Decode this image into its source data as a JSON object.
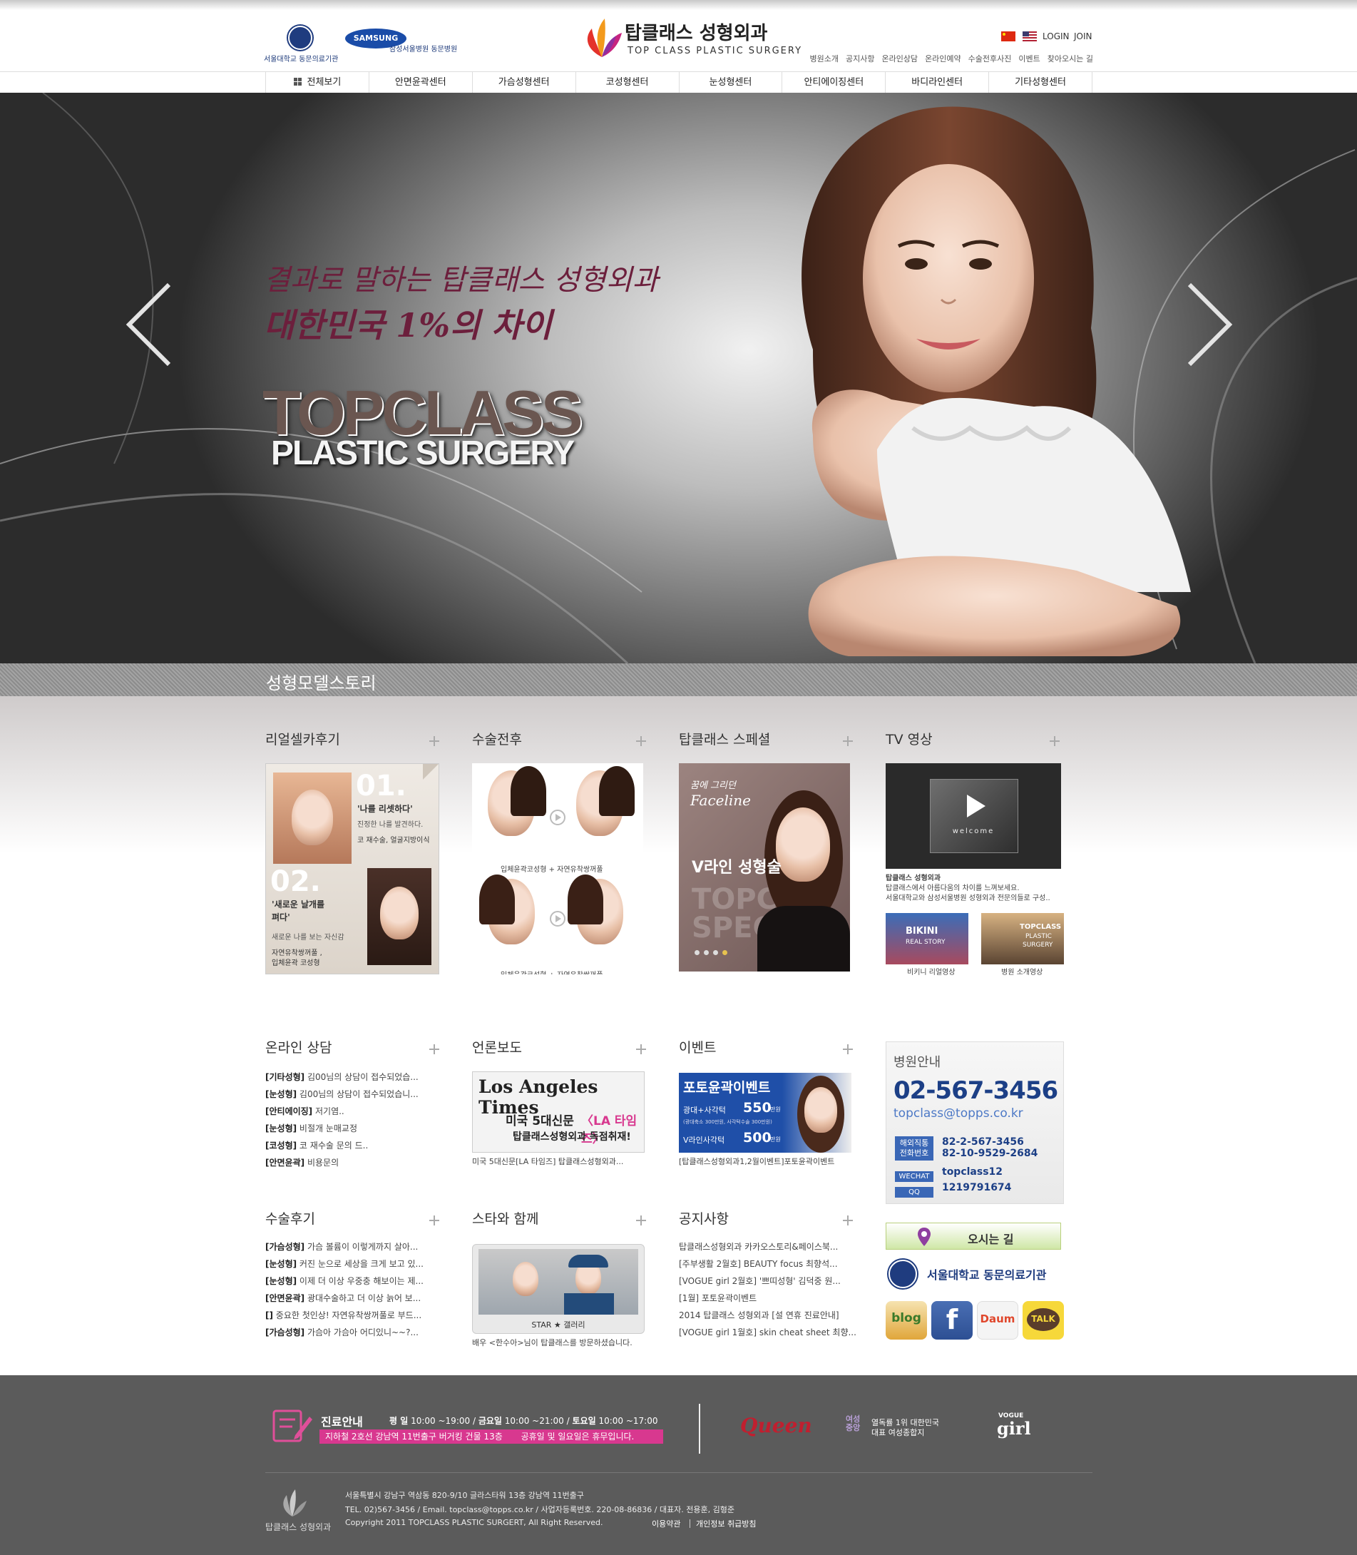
{
  "header": {
    "partner1": "서울대학교 동문의료기관",
    "partner2_brand": "SAMSUNG",
    "partner2": "삼성서울병원 동문병원",
    "logo_ko": "탑클래스 성형외과",
    "logo_en": "TOP CLASS PLASTIC SURGERY",
    "login": "LOGIN",
    "join": "JOIN",
    "util_menu": [
      "병원소개",
      "공지사항",
      "온라인상담",
      "온라인예약",
      "수술전후사진",
      "이벤트",
      "찾아오시는 길"
    ]
  },
  "gnb": [
    "전체보기",
    "안면윤곽센터",
    "가슴성형센터",
    "코성형센터",
    "눈성형센터",
    "안티에이징센터",
    "바디라인센터",
    "기타성형센터"
  ],
  "hero": {
    "script_line1": "결과로 말하는 탑클래스 성형외과",
    "script_line2": "대한민국 1%의 차이",
    "title1": "TOPCLASS",
    "title2": "PLASTIC SURGERY",
    "story_label": "성형모델스토리"
  },
  "panels": {
    "selfie": {
      "title": "리얼셀카후기",
      "n1": "01.",
      "q1": "'나를 리셋하다'",
      "d1": "진정한 나를 발견하다.",
      "s1": "코 재수술, 얼굴지방이식",
      "n2": "02.",
      "q2a": "'새로운 날개를",
      "q2b": "펴다'",
      "d2": "새로운 나를 보는 자신감",
      "s2a": "자연유착쌍꺼풀 ,",
      "s2b": "입체윤곽 코성형"
    },
    "beforeafter": {
      "title": "수술전후",
      "cap1": "입체윤곽코성형 + 자연유착쌍꺼풀",
      "cap2": "입체윤곽코성형 + 자연유착쌍꺼풀"
    },
    "special": {
      "title": "탑클래스 스페셜",
      "script": "꿈에 그리던",
      "faceline": "Faceline",
      "vline": "V라인 성형술",
      "wm1": "TOPC",
      "wm2": "SPEC"
    },
    "tv": {
      "title": "TV 영상",
      "welcome": "welcome",
      "heading": "탑클래스 성형외과",
      "line1": "탑클래스에서 아름다움의 차이를 느껴보세요.",
      "line2": "서울대학교와 삼성서울병원 성형외과 전문의들로 구성..",
      "thumb1_a": "BIKINI",
      "thumb1_b": "REAL STORY",
      "thumb2_a": "TOPCLASS",
      "thumb2_b": "PLASTIC",
      "thumb2_c": "SURGERY",
      "cap1": "비키니 리얼영상",
      "cap2": "병원 소개영상"
    },
    "consult": {
      "title": "온라인 상담",
      "items": [
        {
          "tag": "[기타성형]",
          "text": "김00님의 상담이 접수되었습..."
        },
        {
          "tag": "[눈성형]",
          "text": "김00님의 상담이 접수되었습니..."
        },
        {
          "tag": "[안티에이징]",
          "text": "저기염.."
        },
        {
          "tag": "[눈성형]",
          "text": "비절개 눈매교정"
        },
        {
          "tag": "[코성형]",
          "text": "코 재수술 문의 드.."
        },
        {
          "tag": "[안면윤곽]",
          "text": "비용문의"
        }
      ]
    },
    "press": {
      "title": "언론보도",
      "paper": "Los Angeles Times",
      "line1": "미국 5대신문",
      "line1b": "〈LA 타임즈〉",
      "line2": "탑클래스성형외과 독점취재!",
      "caption": "미국 5대신문[LA 타임즈] 탑클래스성형외과..."
    },
    "event": {
      "title": "이벤트",
      "banner": "포토윤곽이벤트",
      "row1": "광대+사각턱",
      "price1": "550",
      "row1sub": "(광대축소 300만원, 사각턱수술 300만원)",
      "row2": "V라인사각턱",
      "price2": "500",
      "unit": "만원",
      "caption": "[탑클래스성형외과1,2월이벤트]포토윤곽이벤트"
    },
    "info": {
      "title": "병원안내",
      "phone": "02-567-3456",
      "email": "topclass@topps.co.kr",
      "intl_label_a": "해외직통",
      "intl_label_b": "전화번호",
      "intl1": "82-2-567-3456",
      "intl2": "82-10-9529-2684",
      "wechat_label": "WECHAT",
      "wechat": "topclass12",
      "qq_label": "QQ",
      "qq": "1219791674"
    },
    "review": {
      "title": "수술후기",
      "items": [
        {
          "tag": "[가슴성형]",
          "text": "가슴 볼륨이 이렇게까지 살아..."
        },
        {
          "tag": "[눈성형]",
          "text": "커진 눈으로 세상을 크게 보고 있..."
        },
        {
          "tag": "[눈성형]",
          "text": "이제 더 이상 우중충 해보이는 제..."
        },
        {
          "tag": "[안면윤곽]",
          "text": "광대수술하고 더 이상 늙어 보..."
        },
        {
          "tag": "[]",
          "text": "중요한 첫인상! 자연유착쌍꺼풀로 부드..."
        },
        {
          "tag": "[가슴성형]",
          "text": "가슴아 가슴아 어디있니~~?..."
        }
      ]
    },
    "star": {
      "title": "스타와 함께",
      "label": "STAR ★ 갤러리",
      "caption": "배우 <한수아>님이 탑클래스를 방문하셨습니다."
    },
    "notice": {
      "title": "공지사항",
      "items": [
        "탑클래스성형외과 카카오스토리&페이스북...",
        "[주부생활 2월호] BEAUTY focus 최향석...",
        "[VOGUE girl 2월호] '쁘띠성형' 김덕중 원...",
        "[1월] 포토윤곽이벤트",
        "2014 탑클래스 성형외과 [설 연휴 진료안내]",
        "[VOGUE girl 1월호] skin cheat sheet 최향..."
      ]
    },
    "side": {
      "map": "오시는 길",
      "snu": "서울대학교 동문의료기관",
      "blog": "blog",
      "facebook": "f",
      "daum": "Daum",
      "talk": "TALK"
    }
  },
  "footer": {
    "hours_title": "진료안내",
    "weekday": "평  일",
    "weekday_time": "10:00 ~19:00",
    "friday": "금요일",
    "friday_time": "10:00 ~21:00",
    "saturday": "토요일",
    "saturday_time": "10:00 ~17:00",
    "location": "지하철 2호선 강남역 11번출구 버거킹 건물 13층",
    "closed": "공휴일 및 일요일은 휴무입니다.",
    "queen": "Queen",
    "mag_small": "여성중앙",
    "mag1": "열독률 1위 대한민국",
    "mag2": "대표 여성종합지",
    "vogue_small": "VOGUE",
    "vogue": "girl",
    "foot_logo": "탑클래스 성형외과",
    "addr1": "서울특별시 강남구 역삼동 820-9/10 글라스타워 13층 강남역 11번출구",
    "addr2": "TEL. 02)567-3456 / Email. topclass@topps.co.kr / 사업자등록번호. 220-08-86836 / 대표자. 전용훈, 김형준",
    "copyright": "Copyright  2011  TOPCLASS PLASTIC SURGERT, All Right Reserved.",
    "terms": "이용약관",
    "privacy": "개인정보 취급방침"
  },
  "colors": {
    "accent_blue": "#1f4fa8",
    "footer_bg": "#5b5b5b",
    "pink": "#d8388f"
  }
}
